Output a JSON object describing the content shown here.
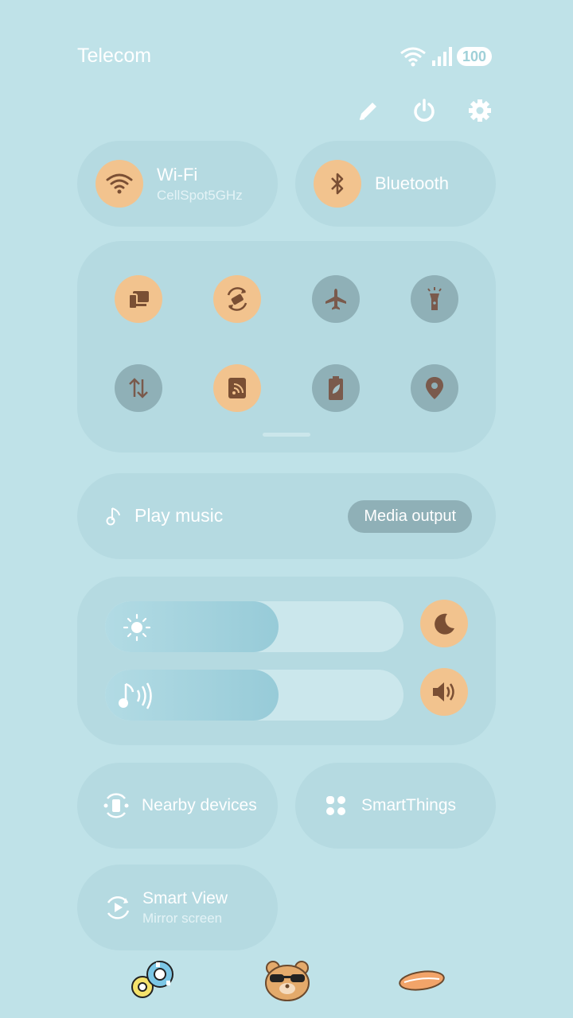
{
  "status_bar": {
    "carrier": "Telecom",
    "battery": "100"
  },
  "top_actions": {
    "icons": [
      "pencil-icon",
      "power-icon",
      "settings-icon"
    ]
  },
  "wifi": {
    "label": "Wi-Fi",
    "network": "CellSpot5GHz",
    "on": true
  },
  "bluetooth": {
    "label": "Bluetooth",
    "on": true
  },
  "quick_toggles": [
    {
      "icon": "screen-share-icon",
      "on": true
    },
    {
      "icon": "auto-rotate-icon",
      "on": true
    },
    {
      "icon": "airplane-icon",
      "on": false
    },
    {
      "icon": "flashlight-icon",
      "on": false
    },
    {
      "icon": "mobile-data-icon",
      "on": false
    },
    {
      "icon": "nfc-icon",
      "on": true
    },
    {
      "icon": "power-saving-icon",
      "on": false
    },
    {
      "icon": "location-icon",
      "on": false
    }
  ],
  "music": {
    "label": "Play music",
    "media_output": "Media output"
  },
  "brightness": {
    "level_percent": 58
  },
  "volume": {
    "level_percent": 58
  },
  "nearby": {
    "label": "Nearby devices"
  },
  "smartthings": {
    "label": "SmartThings"
  },
  "smart_view": {
    "label": "Smart View",
    "sub": "Mirror screen"
  },
  "colors": {
    "background": "#bfe2e8",
    "accent": "#f2c38e",
    "inactive": "#8fb0b7",
    "icon": "#7a4f34"
  }
}
